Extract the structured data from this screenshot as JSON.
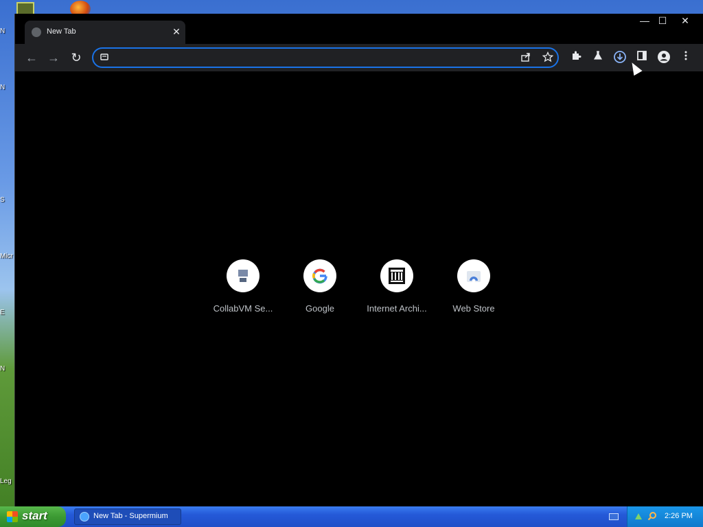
{
  "desktop": {
    "fragments": [
      "N",
      "N",
      "S",
      "Micr St",
      "E",
      "N",
      "Leg"
    ]
  },
  "browser": {
    "tab": {
      "title": "New Tab",
      "close_glyph": "✕"
    },
    "window_controls": {
      "minimize": "—",
      "maximize": "☐",
      "close": "✕"
    },
    "toolbar": {
      "back": "←",
      "forward": "→",
      "reload": "↻",
      "omnibox": {
        "value": "",
        "placeholder": ""
      },
      "icons": [
        "share-icon",
        "star-icon",
        "extensions-icon",
        "labs-icon",
        "download-icon",
        "side-panel-icon",
        "profile-icon",
        "menu-icon"
      ]
    },
    "shortcuts": [
      {
        "label": "CollabVM Se...",
        "icon": "collabvm-icon"
      },
      {
        "label": "Google",
        "icon": "google-icon"
      },
      {
        "label": "Internet Archi...",
        "icon": "internet-archive-icon"
      },
      {
        "label": "Web Store",
        "icon": "web-store-icon"
      }
    ]
  },
  "taskbar": {
    "start_label": "start",
    "task_label": "New Tab - Supermium",
    "clock": "2:26 PM"
  }
}
